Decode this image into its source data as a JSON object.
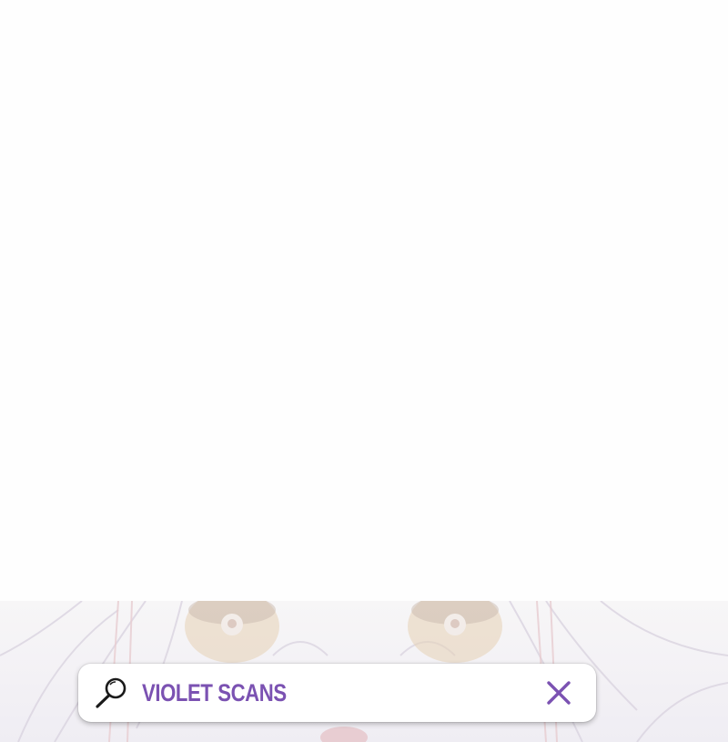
{
  "search_bar": {
    "query": "VIOLET SCANS",
    "search_icon": "search-icon",
    "close_icon": "close-icon"
  },
  "colors": {
    "accent": "#7b52b2",
    "background": "#fefefe"
  },
  "art_panel": {
    "description_icon": "illustration-background"
  }
}
